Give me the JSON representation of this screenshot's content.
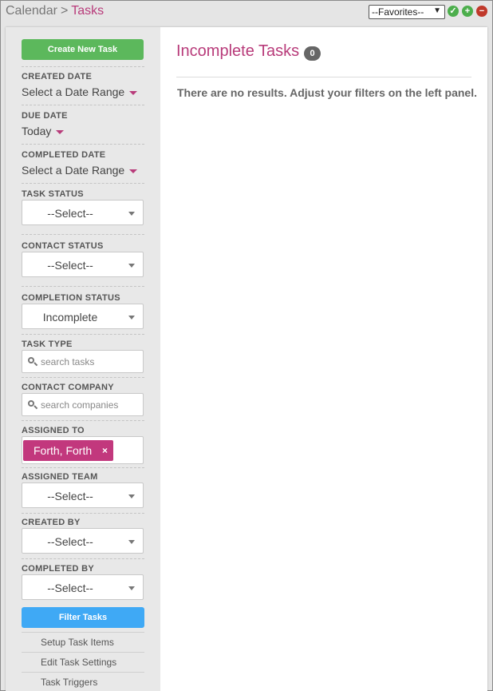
{
  "header": {
    "breadcrumb_root": "Calendar",
    "breadcrumb_sep": ">",
    "breadcrumb_current": "Tasks",
    "favorites_value": "--Favorites--",
    "icons": [
      "check-icon",
      "plus-icon",
      "minus-icon"
    ]
  },
  "sidebar": {
    "create_button": "Create New Task",
    "created_date": {
      "label": "CREATED DATE",
      "value": "Select a Date Range"
    },
    "due_date": {
      "label": "DUE DATE",
      "value": "Today"
    },
    "completed_date": {
      "label": "COMPLETED DATE",
      "value": "Select a Date Range"
    },
    "task_status": {
      "label": "TASK STATUS",
      "value": "--Select--"
    },
    "contact_status": {
      "label": "CONTACT STATUS",
      "value": "--Select--"
    },
    "completion_status": {
      "label": "COMPLETION STATUS",
      "value": "Incomplete"
    },
    "task_type": {
      "label": "TASK TYPE",
      "placeholder": "search tasks"
    },
    "contact_company": {
      "label": "CONTACT COMPANY",
      "placeholder": "search companies"
    },
    "assigned_to": {
      "label": "ASSIGNED TO",
      "chip": "Forth, Forth",
      "chip_remove": "×"
    },
    "assigned_team": {
      "label": "ASSIGNED TEAM",
      "value": "--Select--"
    },
    "created_by": {
      "label": "CREATED BY",
      "value": "--Select--"
    },
    "completed_by": {
      "label": "COMPLETED BY",
      "value": "--Select--"
    },
    "filter_button": "Filter Tasks",
    "links": [
      "Setup Task Items",
      "Edit Task Settings",
      "Task Triggers"
    ]
  },
  "main": {
    "title": "Incomplete Tasks",
    "count": "0",
    "message": "There are no results. Adjust your filters on the left panel."
  },
  "colors": {
    "accent": "#b83b7a",
    "create_button": "#5cb85c",
    "filter_button": "#3fa9f5"
  }
}
